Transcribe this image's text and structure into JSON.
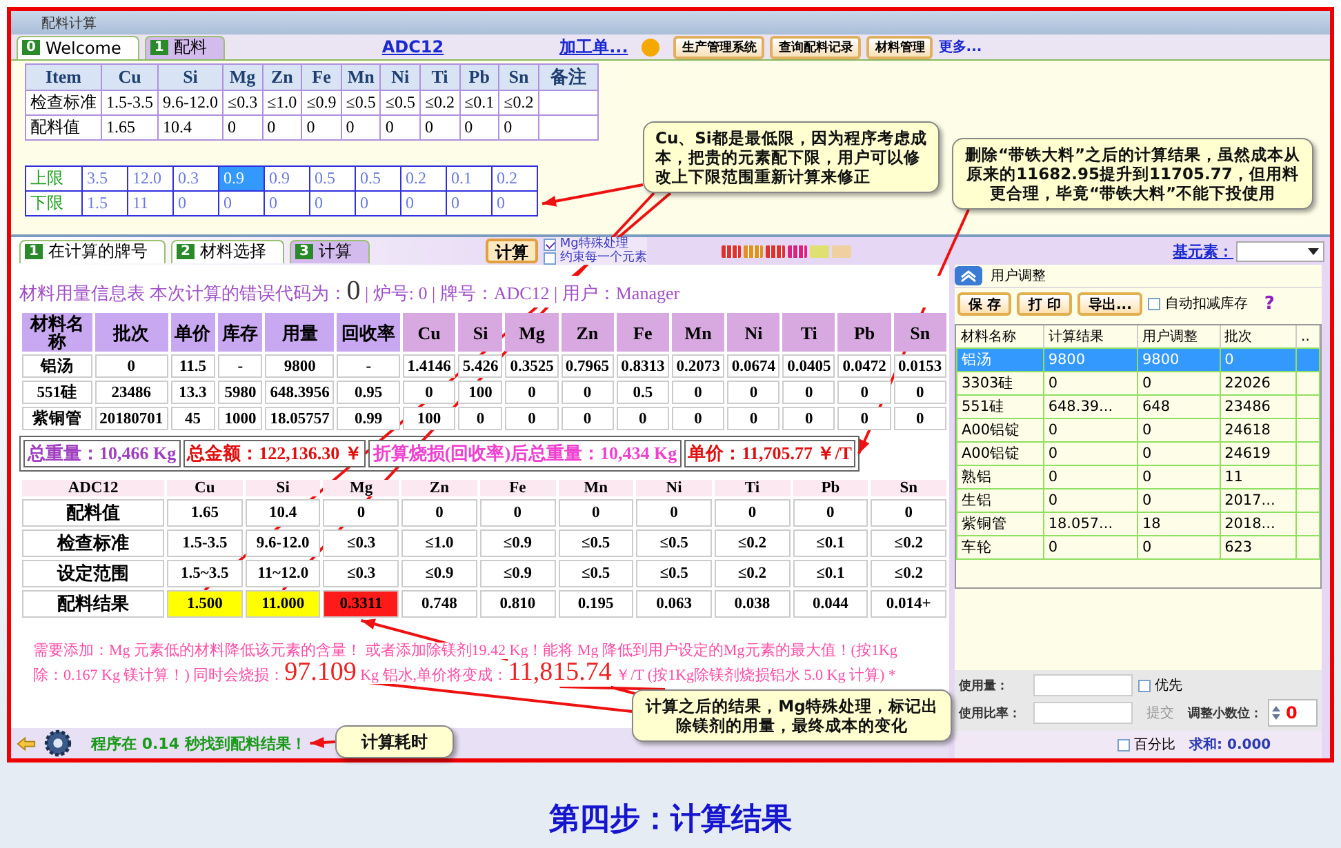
{
  "window": {
    "title": "配料计算"
  },
  "top_tabs": [
    {
      "number": "0",
      "label": "Welcome",
      "selected": false
    },
    {
      "number": "1",
      "label": "配料",
      "selected": true
    }
  ],
  "grade_link": "ADC12",
  "work_order_link": "加工单...",
  "toolbar_buttons": [
    "生产管理系统",
    "查询配料记录",
    "材料管理"
  ],
  "more_link": "更多...",
  "spec_table": {
    "columns": [
      "Item",
      "Cu",
      "Si",
      "Mg",
      "Zn",
      "Fe",
      "Mn",
      "Ni",
      "Ti",
      "Pb",
      "Sn",
      "备注"
    ],
    "rows": [
      [
        "检查标准",
        "1.5-3.5",
        "9.6-12.0",
        "≤0.3",
        "≤1.0",
        "≤0.9",
        "≤0.5",
        "≤0.5",
        "≤0.2",
        "≤0.1",
        "≤0.2"
      ],
      [
        "配料值",
        "1.65",
        "10.4",
        "0",
        "0",
        "0",
        "0",
        "0",
        "0",
        "0",
        "0"
      ]
    ]
  },
  "limits_table": {
    "rows": [
      {
        "label": "上限",
        "cells": [
          {
            "value": "3.5",
            "selected": false
          },
          {
            "value": "12.0",
            "selected": false
          },
          {
            "value": "0.3",
            "selected": false
          },
          {
            "value": "0.9",
            "selected": true
          },
          {
            "value": "0.9",
            "selected": false
          },
          {
            "value": "0.5",
            "selected": false
          },
          {
            "value": "0.5",
            "selected": false
          },
          {
            "value": "0.2",
            "selected": false
          },
          {
            "value": "0.1",
            "selected": false
          },
          {
            "value": "0.2",
            "selected": false
          }
        ]
      },
      {
        "label": "下限",
        "cells": [
          {
            "value": "1.5",
            "selected": false
          },
          {
            "value": "11",
            "selected": false
          },
          {
            "value": "0",
            "selected": false
          },
          {
            "value": "0",
            "selected": false
          },
          {
            "value": "0",
            "selected": false
          },
          {
            "value": "0",
            "selected": false
          },
          {
            "value": "0",
            "selected": false
          },
          {
            "value": "0",
            "selected": false
          },
          {
            "value": "0",
            "selected": false
          },
          {
            "value": "0",
            "selected": false
          }
        ]
      }
    ]
  },
  "calc_tabs": [
    {
      "number": "1",
      "label": "在计算的牌号",
      "selected": false
    },
    {
      "number": "2",
      "label": "材料选择",
      "selected": false
    },
    {
      "number": "3",
      "label": "计算",
      "selected": true
    }
  ],
  "calc_button": "计算",
  "options": [
    {
      "label": "Mg特殊处理",
      "checked": true
    },
    {
      "label": "约束每一个元素",
      "checked": false
    }
  ],
  "base_element_link": "基元素：",
  "info_line": {
    "prefix": "材料用量信息表  本次计算的错误代码为：",
    "code": "0",
    "rest": " | 炉号: 0 | 牌号：ADC12 | 用户：Manager"
  },
  "material_table": {
    "columns": [
      "材料名称",
      "批次",
      "单价",
      "库存",
      "用量",
      "回收率",
      "Cu",
      "Si",
      "Mg",
      "Zn",
      "Fe",
      "Mn",
      "Ni",
      "Ti",
      "Pb",
      "Sn"
    ],
    "rows": [
      [
        "铝汤",
        "0",
        "11.5",
        "-",
        "9800",
        "-",
        "1.4146",
        "5.426",
        "0.3525",
        "0.7965",
        "0.8313",
        "0.2073",
        "0.0674",
        "0.0405",
        "0.0472",
        "0.0153"
      ],
      [
        "551硅",
        "23486",
        "13.3",
        "5980",
        "648.3956",
        "0.95",
        "0",
        "100",
        "0",
        "0",
        "0.5",
        "0",
        "0",
        "0",
        "0",
        "0"
      ],
      [
        "紫铜管",
        "20180701",
        "45",
        "1000",
        "18.05757",
        "0.99",
        "100",
        "0",
        "0",
        "0",
        "0",
        "0",
        "0",
        "0",
        "0",
        "0"
      ]
    ]
  },
  "summary": [
    {
      "kind": "weight",
      "text": "总重量：10,466 Kg"
    },
    {
      "kind": "amount",
      "text": "总金额：122,136.30 ￥"
    },
    {
      "kind": "loss",
      "text": "折算烧损(回收率)后总重量：10,434 Kg"
    },
    {
      "kind": "price",
      "text": "单价：11,705.77 ￥/T"
    }
  ],
  "result_table": {
    "columns": [
      "ADC12",
      "Cu",
      "Si",
      "Mg",
      "Zn",
      "Fe",
      "Mn",
      "Ni",
      "Ti",
      "Pb",
      "Sn"
    ],
    "rows": [
      {
        "label": "配料值",
        "values": [
          "1.65",
          "10.4",
          "0",
          "0",
          "0",
          "0",
          "0",
          "0",
          "0",
          "0"
        ]
      },
      {
        "label": "检查标准",
        "values": [
          "1.5-3.5",
          "9.6-12.0",
          "≤0.3",
          "≤1.0",
          "≤0.9",
          "≤0.5",
          "≤0.5",
          "≤0.2",
          "≤0.1",
          "≤0.2"
        ]
      },
      {
        "label": "设定范围",
        "values": [
          "1.5~3.5",
          "11~12.0",
          "≤0.3",
          "≤0.9",
          "≤0.9",
          "≤0.5",
          "≤0.5",
          "≤0.2",
          "≤0.1",
          "≤0.2"
        ]
      }
    ],
    "result": {
      "label": "配料结果",
      "cells": [
        {
          "value": "1.500",
          "color": "#ffff00"
        },
        {
          "value": "11.000",
          "color": "#ffff00"
        },
        {
          "value": "0.3311",
          "color": "#ff1a1a"
        },
        {
          "value": "0.748",
          "color": "#ffffff"
        },
        {
          "value": "0.810",
          "color": "#ffffff"
        },
        {
          "value": "0.195",
          "color": "#ffffff"
        },
        {
          "value": "0.063",
          "color": "#ffffff"
        },
        {
          "value": "0.038",
          "color": "#ffffff"
        },
        {
          "value": "0.044",
          "color": "#ffffff"
        },
        {
          "value": "0.014+",
          "color": "#ffffff"
        }
      ]
    }
  },
  "message": [
    {
      "kind": "text",
      "text": "需要添加：Mg 元素低的材料降低该元素的含量！ 或者添加除镁剂19.42 Kg！能将 Mg 降低到用户设定的Mg元素的最大值！(按1Kg 除：0.167 Kg 镁计算！) 同时会烧损："
    },
    {
      "kind": "big",
      "text": "97.109"
    },
    {
      "kind": "text",
      "text": " Kg 铝水,单价将变成："
    },
    {
      "kind": "big",
      "text": "11,815.74"
    },
    {
      "kind": "text",
      "text": " ￥/T (按1Kg除镁剂烧损铝水  5.0 Kg 计算) *"
    }
  ],
  "status_text": "程序在 0.14 秒找到配料结果！",
  "user_adjust": {
    "title": "用户调整",
    "buttons": [
      "保 存",
      "打 印",
      "导出..."
    ],
    "auto_deduct": {
      "label": "自动扣减库存",
      "checked": false
    },
    "help": "?",
    "columns": [
      "材料名称",
      "计算结果",
      "用户调整",
      "批次",
      ".."
    ],
    "rows": [
      {
        "cells": [
          "铝汤",
          "9800",
          "9800",
          "0"
        ],
        "selected": true
      },
      {
        "cells": [
          "3303硅",
          "0",
          "0",
          "22026"
        ],
        "selected": false
      },
      {
        "cells": [
          "551硅",
          "648.39...",
          "648",
          "23486"
        ],
        "selected": false
      },
      {
        "cells": [
          "A00铝锭",
          "0",
          "0",
          "24618"
        ],
        "selected": false
      },
      {
        "cells": [
          "A00铝锭",
          "0",
          "0",
          "24619"
        ],
        "selected": false
      },
      {
        "cells": [
          "熟铝",
          "0",
          "0",
          "11"
        ],
        "selected": false
      },
      {
        "cells": [
          "生铝",
          "0",
          "0",
          "2017..."
        ],
        "selected": false
      },
      {
        "cells": [
          "紫铜管",
          "18.057...",
          "18",
          "2018..."
        ],
        "selected": false
      },
      {
        "cells": [
          "车轮",
          "0",
          "0",
          "623"
        ],
        "selected": false
      }
    ],
    "usage_label": "使用量：",
    "priority": {
      "label": "优先",
      "checked": false
    },
    "ratio_label": "使用比率：",
    "submit": "提交",
    "decimals_label": "调整小数位：",
    "decimals_value": "0",
    "percent": {
      "label": "百分比",
      "checked": false
    },
    "sum": "求和: 0.000"
  },
  "callouts": [
    {
      "kind": "limits",
      "text": "Cu、Si都是最低限，因为程序考虑成本，把贵的元素配下限，用户可以修改上下限范围重新计算来修正"
    },
    {
      "kind": "cost",
      "text": "删除“带铁大料”之后的计算结果，虽然成本从原来的11682.95提升到11705.77，但用料更合理，毕竟“带铁大料”不能下投使用"
    },
    {
      "kind": "mg",
      "text": "计算之后的结果，Mg特殊处理，标记出除镁剂的用量，最终成本的变化"
    },
    {
      "kind": "time",
      "text": "计算耗时"
    }
  ],
  "caption": "第四步：计算结果"
}
